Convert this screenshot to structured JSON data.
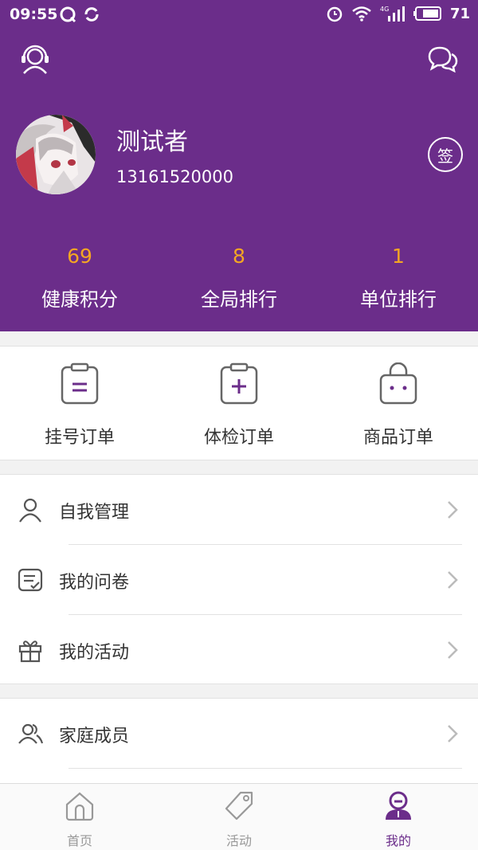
{
  "status_bar": {
    "time": "09:55",
    "network": "4G",
    "battery": "71"
  },
  "colors": {
    "primary": "#6b2d8a",
    "stat_value": "#f4a623"
  },
  "header": {
    "left_icon": "customer-service-icon",
    "right_icon": "chat-icon"
  },
  "profile": {
    "name": "测试者",
    "phone": "13161520000",
    "sign_label": "签"
  },
  "stats": [
    {
      "value": "69",
      "label": "健康积分"
    },
    {
      "value": "8",
      "label": "全局排行"
    },
    {
      "value": "1",
      "label": "单位排行"
    }
  ],
  "orders": [
    {
      "label": "挂号订单",
      "icon": "clipboard-list-icon"
    },
    {
      "label": "体检订单",
      "icon": "clipboard-plus-icon"
    },
    {
      "label": "商品订单",
      "icon": "shopping-bag-icon"
    }
  ],
  "menu": [
    {
      "label": "自我管理",
      "icon": "user-icon"
    },
    {
      "label": "我的问卷",
      "icon": "questionnaire-icon"
    },
    {
      "label": "我的活动",
      "icon": "gift-icon"
    },
    {
      "label": "家庭成员",
      "icon": "family-icon"
    }
  ],
  "tabs": [
    {
      "label": "首页",
      "icon": "home-icon",
      "active": false
    },
    {
      "label": "活动",
      "icon": "tag-icon",
      "active": false
    },
    {
      "label": "我的",
      "icon": "profile-icon",
      "active": true
    }
  ]
}
